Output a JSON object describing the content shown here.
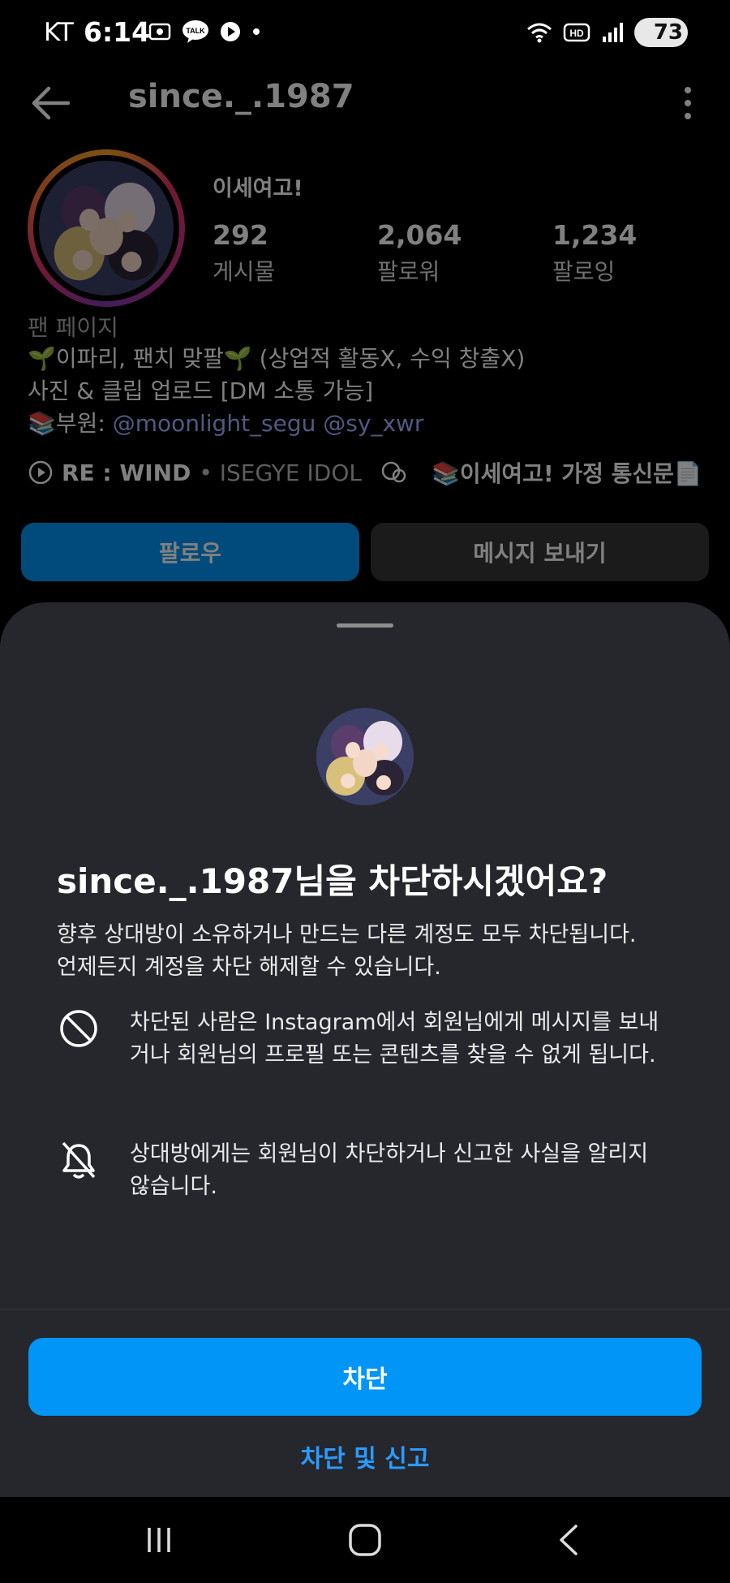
{
  "status_bar": {
    "carrier": "KT",
    "time": "6:14",
    "battery": "73",
    "hd_label": "HD",
    "talk_label": "TALK"
  },
  "profile": {
    "username": "since._.1987",
    "display_name": "이세여고!",
    "stats": [
      {
        "value": "292",
        "label": "게시물"
      },
      {
        "value": "2,064",
        "label": "팔로워"
      },
      {
        "value": "1,234",
        "label": "팔로잉"
      }
    ],
    "category": "팬 페이지",
    "bio_line1": "🌱이파리, 팬치 맞팔🌱 (상업적 활동X, 수익 창출X)",
    "bio_line2": "사진 & 클립 업로드 [DM 소통 가능]",
    "bio_line3_prefix": "📚부원: ",
    "bio_mentions": "@moonlight_segu @sy_xwr",
    "music_title": "RE : WIND",
    "music_artist": "• ISEGYE IDOL",
    "thread_title": "📚이세여고! 가정 통신문📄",
    "follow_label": "팔로우",
    "message_label": "메시지 보내기"
  },
  "sheet": {
    "title": "since._.1987님을 차단하시겠어요?",
    "desc_line1": "향후 상대방이 소유하거나 만드는 다른 계정도 모두 차단됩니다.",
    "desc_line2": "언제든지 계정을 차단 해제할 수 있습니다.",
    "info1": "차단된 사람은 Instagram에서 회원님에게 메시지를 보내거나 회원님의 프로필 또는 콘텐츠를 찾을 수 없게 됩니다.",
    "info2": "상대방에게는 회원님이 차단하거나 신고한 사실을 알리지 않습니다.",
    "block_label": "차단",
    "block_report_label": "차단 및 신고"
  },
  "icons": {
    "back": "arrow-left-icon",
    "more": "vertical-dots-icon",
    "no_entry": "circle-slash-icon",
    "bell_off": "bell-off-icon"
  },
  "colors": {
    "accent": "#0095f6",
    "sheet_bg": "#25272c",
    "link": "#2b9bff"
  }
}
